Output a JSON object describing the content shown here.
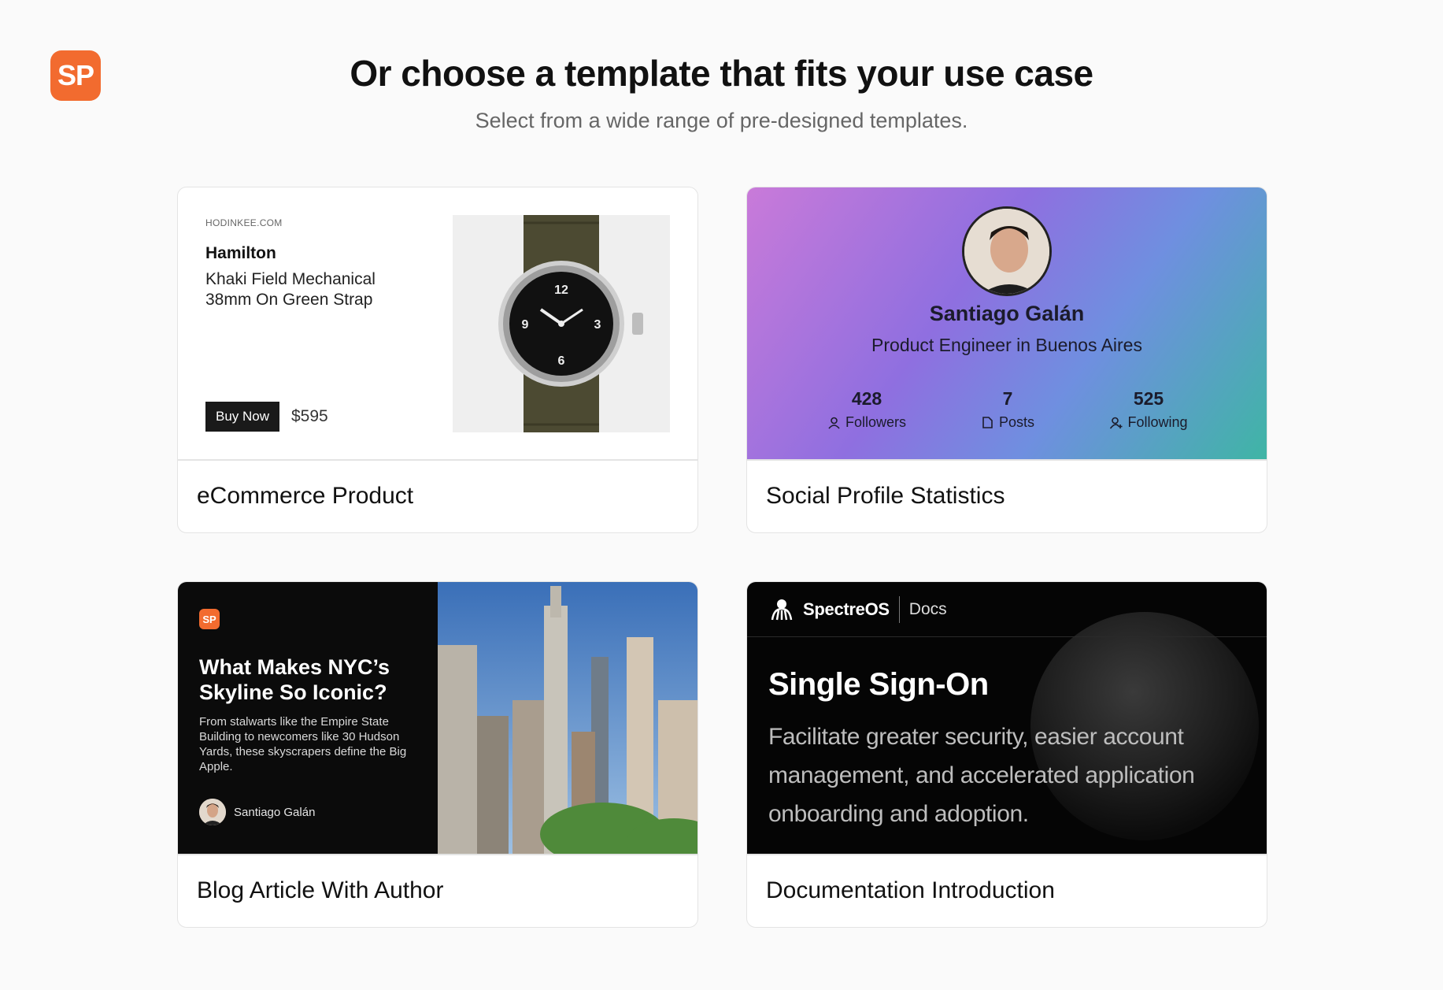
{
  "brand": {
    "logo_text": "SP",
    "accent": "#f26b2f"
  },
  "header": {
    "title": "Or choose a template that fits your use case",
    "subtitle": "Select from a wide range of pre-designed templates."
  },
  "templates": [
    {
      "label": "eCommerce Product",
      "preview": {
        "site": "HODINKEE.COM",
        "brand": "Hamilton",
        "product": "Khaki Field Mechanical 38mm On Green Strap",
        "button": "Buy Now",
        "price": "$595"
      }
    },
    {
      "label": "Social Profile Statistics",
      "preview": {
        "name": "Santiago Galán",
        "role": "Product Engineer in Buenos Aires",
        "stats": [
          {
            "value": "428",
            "label": "Followers",
            "icon": "user-icon"
          },
          {
            "value": "7",
            "label": "Posts",
            "icon": "document-icon"
          },
          {
            "value": "525",
            "label": "Following",
            "icon": "user-plus-icon"
          }
        ]
      }
    },
    {
      "label": "Blog Article With Author",
      "preview": {
        "logo_text": "SP",
        "title": "What Makes NYC’s Skyline So Iconic?",
        "text": "From stalwarts like the Empire State Building to newcomers like 30 Hudson Yards, these skyscrapers define the Big Apple.",
        "author": "Santiago Galán"
      }
    },
    {
      "label": "Documentation Introduction",
      "preview": {
        "brand": "SpectreOS",
        "section": "Docs",
        "title": "Single Sign-On",
        "text": "Facilitate greater security, easier account management, and accelerated application onboarding and adoption."
      }
    }
  ]
}
